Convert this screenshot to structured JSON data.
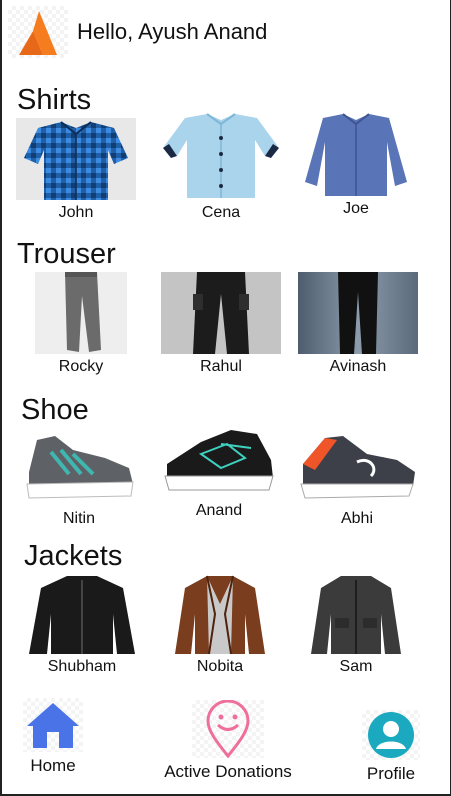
{
  "header": {
    "greeting": "Hello, Ayush Anand",
    "logo_icon": "triangle-logo-icon",
    "logo_color": "#f57c1f"
  },
  "sections": [
    {
      "title": "Shirts",
      "items": [
        {
          "label": "John",
          "icon": "shirt-icon",
          "color": "#1f5fa8"
        },
        {
          "label": "Cena",
          "icon": "shirt-icon",
          "color": "#a9d4ec"
        },
        {
          "label": "Joe",
          "icon": "shirt-icon",
          "color": "#5a74b8"
        }
      ]
    },
    {
      "title": "Trouser",
      "items": [
        {
          "label": "Rocky",
          "icon": "trouser-icon",
          "color": "#6b6b6b"
        },
        {
          "label": "Rahul",
          "icon": "trouser-icon",
          "color": "#1c1c1c"
        },
        {
          "label": "Avinash",
          "icon": "trouser-icon",
          "color": "#111111"
        }
      ]
    },
    {
      "title": "Shoe",
      "items": [
        {
          "label": "Nitin",
          "icon": "sneaker-icon",
          "color": "#5e6266"
        },
        {
          "label": "Anand",
          "icon": "sneaker-icon",
          "color": "#1a1a1a"
        },
        {
          "label": "Abhi",
          "icon": "sneaker-icon",
          "color": "#3d4048"
        }
      ]
    },
    {
      "title": "Jackets",
      "items": [
        {
          "label": "Shubham",
          "icon": "jacket-icon",
          "color": "#1a1a1a"
        },
        {
          "label": "Nobita",
          "icon": "jacket-icon",
          "color": "#7a3d1e"
        },
        {
          "label": "Sam",
          "icon": "jacket-icon",
          "color": "#3b3b3b"
        }
      ]
    }
  ],
  "bottom_nav": [
    {
      "label": "Home",
      "icon": "home-icon",
      "color": "#4a73e8"
    },
    {
      "label": "Active Donations",
      "icon": "location-smile-icon",
      "color": "#ef6f9c"
    },
    {
      "label": "Profile",
      "icon": "profile-icon",
      "color": "#1aa9bf"
    }
  ]
}
